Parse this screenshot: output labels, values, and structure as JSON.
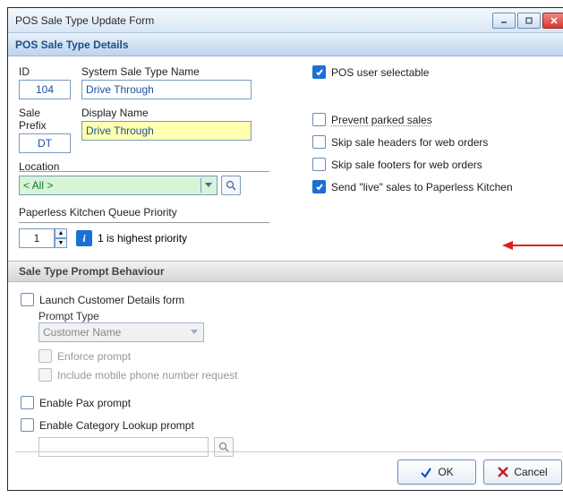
{
  "window": {
    "title": "POS Sale Type Update Form"
  },
  "header": {
    "title": "POS Sale Type Details"
  },
  "fields": {
    "id_label": "ID",
    "id_value": "104",
    "system_name_label": "System Sale Type Name",
    "system_name_value": "Drive Through",
    "prefix_label": "Sale Prefix",
    "prefix_value": "DT",
    "display_name_label": "Display Name",
    "display_name_value": "Drive Through",
    "location_label": "Location",
    "location_value": "< All >",
    "priority_label": "Paperless Kitchen Queue Priority",
    "priority_value": "1",
    "priority_hint": "1 is highest priority"
  },
  "options": {
    "user_selectable": "POS user selectable",
    "prevent_parked": "Prevent parked sales",
    "skip_headers": "Skip sale headers for web orders",
    "skip_footers": "Skip sale footers for web orders",
    "send_live": "Send \"live\" sales to Paperless Kitchen"
  },
  "behaviour": {
    "header": "Sale Type Prompt Behaviour",
    "launch_cust": "Launch Customer Details form",
    "prompt_type_label": "Prompt Type",
    "prompt_type_value": "Customer Name",
    "enforce": "Enforce prompt",
    "include_mobile": "Include mobile phone number request",
    "enable_pax": "Enable Pax prompt",
    "enable_cat": "Enable Category Lookup prompt"
  },
  "buttons": {
    "ok": "OK",
    "cancel": "Cancel"
  }
}
